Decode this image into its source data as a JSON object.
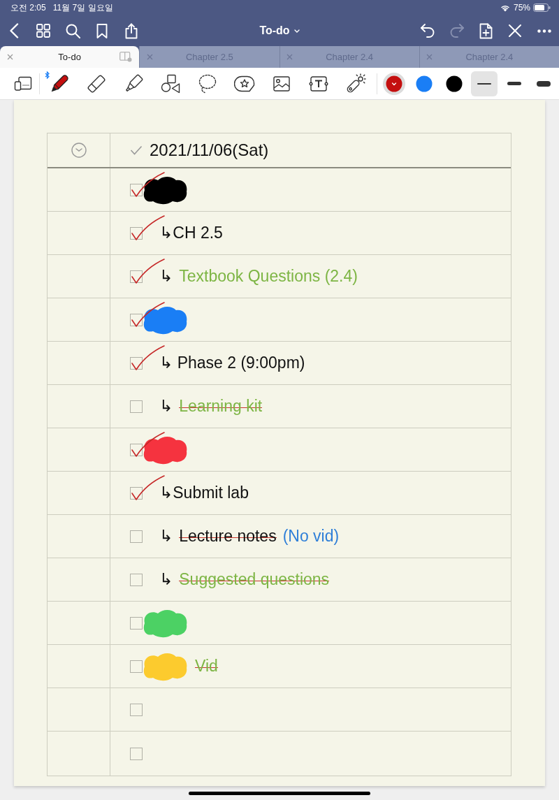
{
  "status_bar": {
    "time": "오전 2:05",
    "date": "11월 7일 일요일",
    "battery": "75%"
  },
  "nav_bar": {
    "title": "To-do",
    "actions": [
      {
        "kind": "undo",
        "disabled": false
      },
      {
        "kind": "redo",
        "disabled": true
      },
      {
        "kind": "add_page",
        "disabled": false
      },
      {
        "kind": "close",
        "disabled": false
      },
      {
        "kind": "more",
        "disabled": false
      }
    ]
  },
  "tabs": [
    {
      "label": "To-do",
      "selected": true
    },
    {
      "label": "Chapter 2.5",
      "selected": false
    },
    {
      "label": "Chapter 2.4",
      "selected": false
    },
    {
      "label": "Chapter 2.4",
      "selected": false
    }
  ],
  "toolbar": {
    "tools": [
      {
        "kind": "pen",
        "selected": true
      },
      {
        "kind": "eraser",
        "selected": false
      },
      {
        "kind": "highlighter",
        "selected": false
      },
      {
        "kind": "shapes",
        "selected": false
      },
      {
        "kind": "lasso",
        "selected": false
      },
      {
        "kind": "sticker",
        "selected": false
      },
      {
        "kind": "image",
        "selected": false
      },
      {
        "kind": "text",
        "selected": false
      },
      {
        "kind": "laser",
        "selected": false
      }
    ],
    "colors": [
      {
        "color": "#c40f0f",
        "selected": true
      },
      {
        "color": "#1a7ef5",
        "selected": false
      },
      {
        "color": "#000000",
        "selected": false
      }
    ],
    "widths": [
      {
        "kind": "thin",
        "selected": true
      },
      {
        "kind": "medium",
        "selected": false
      },
      {
        "kind": "thick",
        "selected": false
      }
    ]
  },
  "page": {
    "header": {
      "date": "2021/11/06(Sat)"
    },
    "rows": [
      {
        "checked": true,
        "marks": [
          {
            "kind": "scribble",
            "color": "#000000"
          }
        ]
      },
      {
        "checked": true,
        "marks": [
          {
            "kind": "text",
            "text": "↳CH 2.5",
            "color": "#111111",
            "struck": false
          }
        ]
      },
      {
        "checked": true,
        "marks": [
          {
            "kind": "text",
            "text": "↳",
            "color": "#111111",
            "struck": false
          },
          {
            "kind": "text",
            "text": "Textbook Questions (2.4)",
            "color": "#7db544",
            "struck": false
          }
        ]
      },
      {
        "checked": true,
        "marks": [
          {
            "kind": "scribble",
            "color": "#1a7ef5"
          }
        ]
      },
      {
        "checked": true,
        "marks": [
          {
            "kind": "text",
            "text": "↳ Phase 2 (9:00pm)",
            "color": "#111111",
            "struck": false
          }
        ]
      },
      {
        "checked": false,
        "marks": [
          {
            "kind": "text",
            "text": "↳",
            "color": "#111111",
            "struck": false
          },
          {
            "kind": "text",
            "text": "Learning kit",
            "color": "#7db544",
            "struck": true
          }
        ]
      },
      {
        "checked": true,
        "marks": [
          {
            "kind": "scribble",
            "color": "#f5333f"
          }
        ]
      },
      {
        "checked": true,
        "marks": [
          {
            "kind": "text",
            "text": "↳Submit lab",
            "color": "#111111",
            "struck": false
          }
        ]
      },
      {
        "checked": false,
        "marks": [
          {
            "kind": "text",
            "text": "↳",
            "color": "#111111",
            "struck": false
          },
          {
            "kind": "text",
            "text": "Lecture notes",
            "color": "#111111",
            "struck": true
          },
          {
            "kind": "text",
            "text": "(No vid)",
            "color": "#2f7fd8",
            "struck": false
          }
        ]
      },
      {
        "checked": false,
        "marks": [
          {
            "kind": "text",
            "text": "↳",
            "color": "#111111",
            "struck": false
          },
          {
            "kind": "text",
            "text": "Suggested questions",
            "color": "#7db544",
            "struck": true
          }
        ]
      },
      {
        "checked": false,
        "marks": [
          {
            "kind": "scribble",
            "color": "#4cd164"
          }
        ]
      },
      {
        "checked": false,
        "marks": [
          {
            "kind": "scribble",
            "color": "#fccb2e"
          },
          {
            "kind": "text",
            "text": "Vid",
            "color": "#7db544",
            "struck": true
          }
        ]
      },
      {
        "checked": false
      },
      {
        "checked": false
      }
    ]
  }
}
